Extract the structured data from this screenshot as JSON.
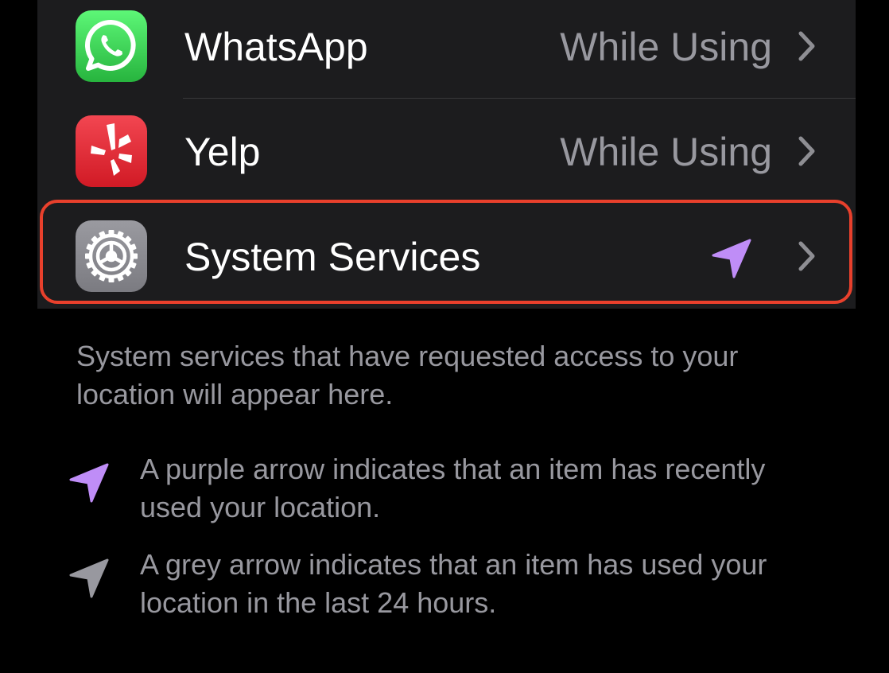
{
  "rows": [
    {
      "name": "WhatsApp",
      "value": "While Using",
      "icon": "whatsapp-icon"
    },
    {
      "name": "Yelp",
      "value": "While Using",
      "icon": "yelp-icon"
    },
    {
      "name": "System Services",
      "icon": "settings-gear-icon",
      "status_icon": "location-arrow-icon",
      "status_color": "#bf8df7"
    }
  ],
  "footer": {
    "text": "System services that have requested access to your location will appear here."
  },
  "legend": [
    {
      "text": "A purple arrow indicates that an item has recently used your location.",
      "color": "#bf8df7"
    },
    {
      "text": "A grey arrow indicates that an item has used your location in the last 24 hours.",
      "color": "#98989f"
    }
  ],
  "colors": {
    "highlight_border": "#e8402c",
    "row_background": "#1c1c1e",
    "secondary_text": "#98989f"
  }
}
